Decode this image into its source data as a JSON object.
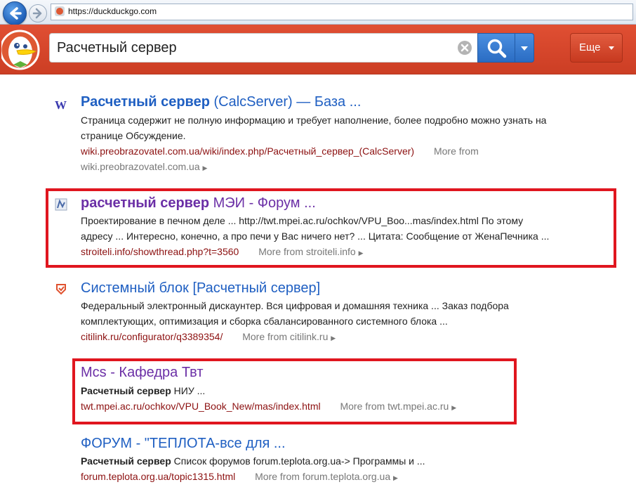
{
  "browser": {
    "url": "https://duckduckgo.com"
  },
  "search": {
    "query": "Расчетный сервер",
    "more_label": "Еще"
  },
  "results": [
    {
      "title_bold": "Расчетный сервер",
      "title_rest": " (CalcServer) — База ...",
      "snippet_line1": "Страница содержит не полную информацию и требует наполнение, более подробно можно узнать на",
      "snippet_line2": "странице Обсуждение.",
      "url": "wiki.preobrazovatel.com.ua/wiki/index.php/Расчетный_сервер_(CalcServer)",
      "more_from": "More from",
      "more_from_line2": "wiki.preobrazovatel.com.ua"
    },
    {
      "title_bold": "расчетный сервер",
      "title_rest": " МЭИ - Форум ...",
      "snippet_line1": "Проектирование в печном деле ... http://twt.mpei.ac.ru/ochkov/VPU_Boo...mas/index.html По этому",
      "snippet_line2": "адресу ... Интересно, конечно, а про печи у Вас ничего нет? ... Цитата: Сообщение от ЖенаПечника ...",
      "url": "stroiteli.info/showthread.php?t=3560",
      "more_from": "More from stroiteli.info"
    },
    {
      "title": "Системный блок [Расчетный сервер]",
      "snippet_line1": "Федеральный электронный дискаунтер. Вся цифровая и домашняя техника ... Заказ подбора",
      "snippet_line2": "комплектующих, оптимизация и сборка сбалансированного системного блока ...",
      "url": "citilink.ru/configurator/q3389354/",
      "more_from": "More from citilink.ru"
    },
    {
      "title": "Mcs - Кафедра Твт",
      "snippet_bold": "Расчетный сервер",
      "snippet_rest": " НИУ ...",
      "url": "twt.mpei.ac.ru/ochkov/VPU_Book_New/mas/index.html",
      "more_from": "More from twt.mpei.ac.ru"
    },
    {
      "title": "ФОРУМ - \"ТЕПЛОТА-все для ...",
      "snippet_bold": "Расчетный сервер",
      "snippet_rest": " Список форумов forum.teplota.org.ua-> Программы и ...",
      "url": "forum.teplota.org.ua/topic1315.html",
      "more_from": "More from forum.teplota.org.ua"
    }
  ],
  "icons": {
    "wikipedia": "W"
  },
  "colors": {
    "header_red": "#de5833",
    "link_blue": "#1f5fc2",
    "visited_purple": "#6b2fa6",
    "url_red": "#8c1010",
    "highlight_red": "#e0161f",
    "search_blue": "#3577d1"
  }
}
